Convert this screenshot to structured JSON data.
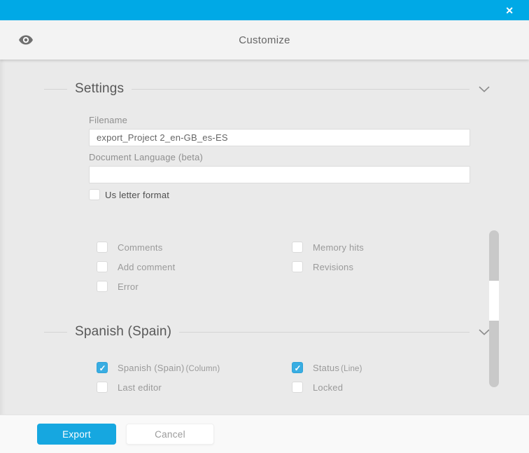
{
  "colors": {
    "topbar_blue": "#00a9e6",
    "button_blue": "#16a7e0",
    "checkbox_checked_blue": "#39ade2"
  },
  "titlebar": {
    "close_glyph": "✕"
  },
  "header": {
    "title": "Customize"
  },
  "sections": {
    "settings": {
      "title": "Settings",
      "filename_label": "Filename",
      "filename_value": "export_Project 2_en-GB_es-ES",
      "doclang_label": "Document Language (beta)",
      "doclang_value": "",
      "us_letter": {
        "label": "Us letter format",
        "checked": false
      },
      "options": [
        {
          "label": "Comments",
          "checked": false
        },
        {
          "label": "Memory hits",
          "checked": false
        },
        {
          "label": "Add comment",
          "checked": false
        },
        {
          "label": "Revisions",
          "checked": false
        },
        {
          "label": "Error",
          "checked": false
        }
      ]
    },
    "language": {
      "title": "Spanish (Spain)",
      "options": [
        {
          "label": "Spanish (Spain)",
          "suffix": "(Column)",
          "checked": true
        },
        {
          "label": "Status",
          "suffix": "(Line)",
          "checked": true
        },
        {
          "label": "Last editor",
          "suffix": "",
          "checked": false
        },
        {
          "label": "Locked",
          "suffix": "",
          "checked": false
        }
      ]
    }
  },
  "footer": {
    "export_label": "Export",
    "cancel_label": "Cancel"
  }
}
